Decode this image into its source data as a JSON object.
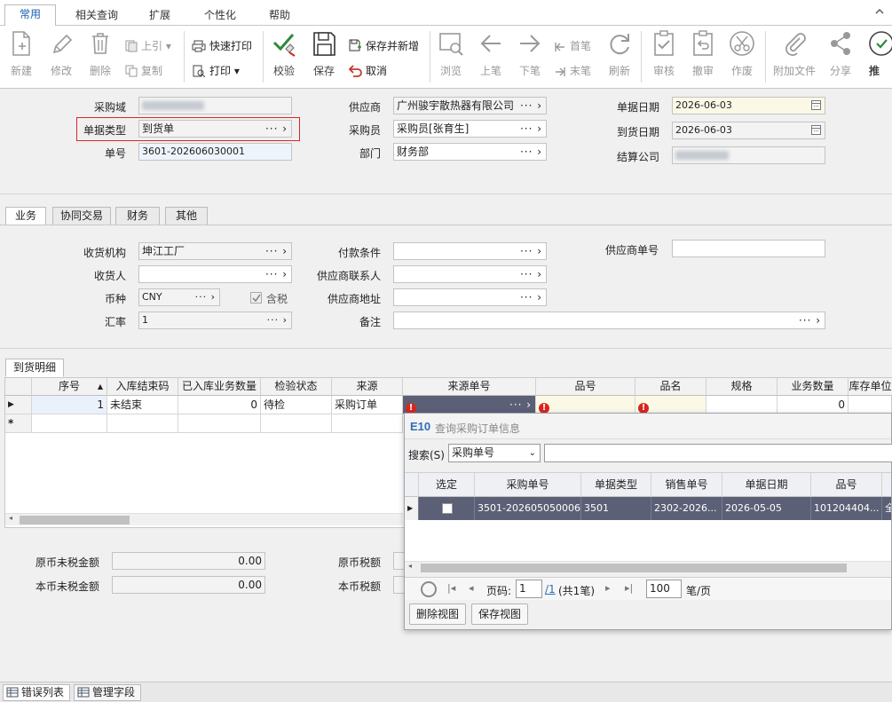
{
  "ribbon": {
    "tabs": [
      "常用",
      "相关查询",
      "扩展",
      "个性化",
      "帮助"
    ]
  },
  "toolbar": {
    "new": "新建",
    "edit": "修改",
    "delete": "删除",
    "prev_ref": "上引",
    "copy": "复制",
    "quick_print": "快速打印",
    "print": "打印",
    "check": "校验",
    "save": "保存",
    "save_new": "保存并新增",
    "cancel": "取消",
    "browse": "浏览",
    "prev": "上笔",
    "next": "下笔",
    "first": "首笔",
    "last": "末笔",
    "refresh": "刷新",
    "approve": "审核",
    "unapprove": "撤审",
    "void": "作废",
    "attach": "附加文件",
    "share": "分享",
    "push": "推"
  },
  "header": {
    "purchase_domain_label": "采购域",
    "doc_type_label": "单据类型",
    "doc_type_value": "到货单",
    "doc_no_label": "单号",
    "doc_no_value": "3601-202606030001",
    "supplier_label": "供应商",
    "supplier_value": "广州骏宇散热器有限公司",
    "buyer_label": "采购员",
    "buyer_value": "采购员[张育生]",
    "dept_label": "部门",
    "dept_value": "财务部",
    "doc_date_label": "单据日期",
    "doc_date_value": "2026-06-03",
    "arrival_date_label": "到货日期",
    "arrival_date_value": "2026-06-03",
    "settle_company_label": "结算公司"
  },
  "section_tabs": [
    "业务",
    "协同交易",
    "财务",
    "其他"
  ],
  "business": {
    "receiving_org_label": "收货机构",
    "receiving_org_value": "坤江工厂",
    "receiver_label": "收货人",
    "currency_label": "币种",
    "currency_value": "CNY",
    "tax_included_label": "含税",
    "exchange_rate_label": "汇率",
    "exchange_rate_value": "1",
    "payment_terms_label": "付款条件",
    "supplier_contact_label": "供应商联系人",
    "supplier_address_label": "供应商地址",
    "remark_label": "备注",
    "supplier_doc_no_label": "供应商单号"
  },
  "detail": {
    "tab": "到货明细",
    "columns": [
      "序号",
      "入库结束码",
      "已入库业务数量",
      "检验状态",
      "来源",
      "来源单号",
      "品号",
      "品名",
      "规格",
      "业务数量",
      "库存单位"
    ],
    "row": {
      "seq": "1",
      "end_code": "未结束",
      "in_qty": "0",
      "inspect": "待检",
      "source": "采购订单",
      "biz_qty": "0"
    },
    "new_row_marker": "*"
  },
  "popup": {
    "logo": "E10",
    "title": "查询采购订单信息",
    "search_label": "搜索(S)",
    "search_field": "采购单号",
    "columns": [
      "选定",
      "采购单号",
      "单据类型",
      "销售单号",
      "单据日期",
      "品号"
    ],
    "row": {
      "po_no": "3501-202605050006",
      "doc_type": "3501",
      "so_no": "2302-2026...",
      "date": "2026-05-05",
      "item_no": "101204404...",
      "extra": "全"
    },
    "page_label": "页码:",
    "page_value": "1",
    "page_total": "/1",
    "page_count": "(共1笔)",
    "page_size": "100",
    "page_unit": "笔/页",
    "delete_view": "删除视图",
    "save_view": "保存视图"
  },
  "totals": {
    "orig_untaxed_label": "原币未税金额",
    "orig_untaxed_value": "0.00",
    "local_untaxed_label": "本币未税金额",
    "local_untaxed_value": "0.00",
    "orig_tax_label": "原币税额",
    "local_tax_label": "本币税额"
  },
  "status_bar": {
    "error_list": "错误列表",
    "manage_fields": "管理字段"
  },
  "colors": {
    "accent": "#1a5fb4",
    "highlight_box": "#d9262a",
    "selected_row": "#5b6076",
    "error": "#d9261c"
  }
}
